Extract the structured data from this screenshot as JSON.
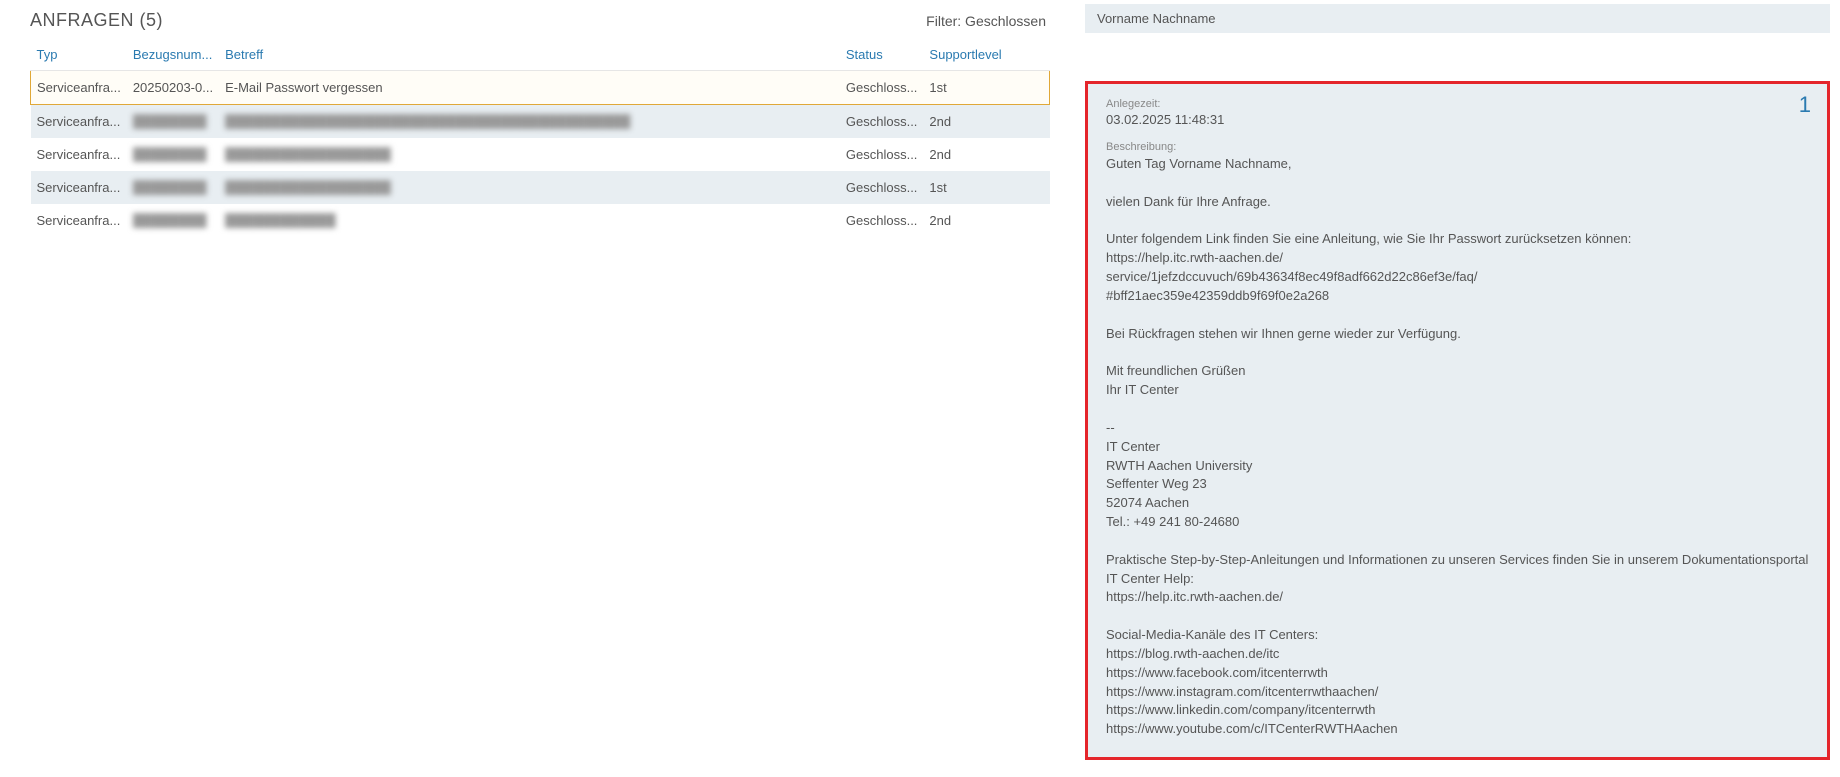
{
  "header": {
    "title": "ANFRAGEN  (5)",
    "filter_label": "Filter: Geschlossen"
  },
  "columns": {
    "typ": "Typ",
    "ref": "Bezugsnum...",
    "subject": "Betreff",
    "status": "Status",
    "level": "Supportlevel"
  },
  "rows": [
    {
      "typ": "Serviceanfra...",
      "ref": "20250203-0...",
      "subject": "E-Mail Passwort vergessen",
      "status": "Geschloss...",
      "level": "1st",
      "selected": true,
      "blur": false
    },
    {
      "typ": "Serviceanfra...",
      "ref": "████████",
      "subject": "████████████████████████████████████████████",
      "status": "Geschloss...",
      "level": "2nd",
      "selected": false,
      "blur": true
    },
    {
      "typ": "Serviceanfra...",
      "ref": "████████",
      "subject": "██████████████████",
      "status": "Geschloss...",
      "level": "2nd",
      "selected": false,
      "blur": true
    },
    {
      "typ": "Serviceanfra...",
      "ref": "████████",
      "subject": "██████████████████",
      "status": "Geschloss...",
      "level": "1st",
      "selected": false,
      "blur": true
    },
    {
      "typ": "Serviceanfra...",
      "ref": "████████",
      "subject": "████████████",
      "status": "Geschloss...",
      "level": "2nd",
      "selected": false,
      "blur": true
    }
  ],
  "user": {
    "name": "Vorname Nachname"
  },
  "detail": {
    "number": "1",
    "created_label": "Anlegezeit:",
    "created_value": "03.02.2025 11:48:31",
    "desc_label": "Beschreibung:",
    "body": "Guten Tag Vorname Nachname,\n\nvielen Dank für Ihre Anfrage.\n\nUnter folgendem Link finden Sie eine Anleitung, wie Sie Ihr Passwort zurücksetzen können:\nhttps://help.itc.rwth-aachen.de/\nservice/1jefzdccuvuch/69b43634f8ec49f8adf662d22c86ef3e/faq/\n#bff21aec359e42359ddb9f69f0e2a268\n\nBei Rückfragen stehen wir Ihnen gerne wieder zur Verfügung.\n\nMit freundlichen Grüßen\nIhr IT Center\n\n--\nIT Center\nRWTH Aachen University\nSeffenter Weg 23\n52074 Aachen\nTel.: +49 241 80-24680\n\nPraktische Step-by-Step-Anleitungen und Informationen zu unseren Services finden Sie in unserem Dokumentationsportal IT Center Help:\nhttps://help.itc.rwth-aachen.de/\n\nSocial-Media-Kanäle des IT Centers:\nhttps://blog.rwth-aachen.de/itc\nhttps://www.facebook.com/itcenterrwth\nhttps://www.instagram.com/itcenterrwthaachen/\nhttps://www.linkedin.com/company/itcenterrwth\nhttps://www.youtube.com/c/ITCenterRWTHAachen"
  }
}
